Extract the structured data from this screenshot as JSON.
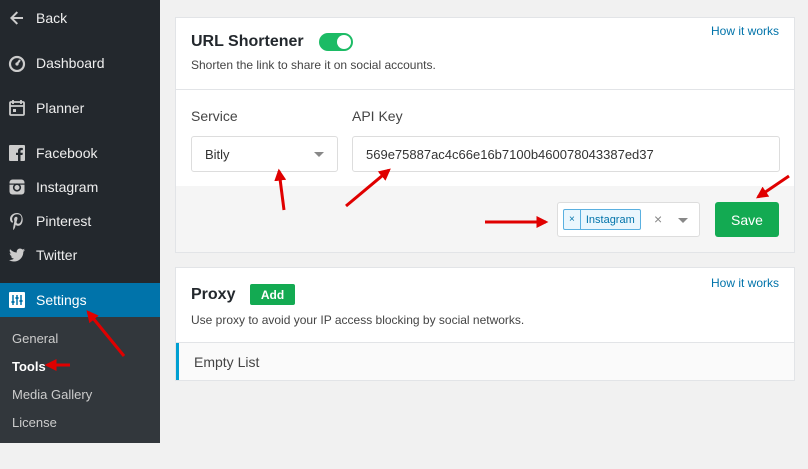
{
  "sidebar": {
    "back_label": "Back",
    "items": [
      {
        "label": "Dashboard",
        "icon": "dashboard-icon"
      },
      {
        "label": "Planner",
        "icon": "calendar-icon"
      },
      {
        "label": "Facebook",
        "icon": "facebook-icon"
      },
      {
        "label": "Instagram",
        "icon": "instagram-icon"
      },
      {
        "label": "Pinterest",
        "icon": "pinterest-icon"
      },
      {
        "label": "Twitter",
        "icon": "twitter-icon"
      },
      {
        "label": "Settings",
        "icon": "settings-icon",
        "active": true
      }
    ],
    "submenu": [
      {
        "label": "General"
      },
      {
        "label": "Tools",
        "current": true
      },
      {
        "label": "Media Gallery"
      },
      {
        "label": "License"
      }
    ]
  },
  "url_shortener": {
    "title": "URL Shortener",
    "enabled": true,
    "description": "Shorten the link to share it on social accounts.",
    "how_it_works": "How it works",
    "service_label": "Service",
    "service_value": "Bitly",
    "api_key_label": "API Key",
    "api_key_value": "569e75887ac4c66e16b7100b460078043387ed37",
    "accounts_tag": "Instagram",
    "tag_remove": "×",
    "clear": "×",
    "save_label": "Save"
  },
  "proxy": {
    "title": "Proxy",
    "add_label": "Add",
    "description": "Use proxy to avoid your IP access blocking by social networks.",
    "how_it_works": "How it works",
    "empty_text": "Empty List"
  },
  "colors": {
    "sidebar_bg": "#23282d",
    "active_bg": "#0073aa",
    "accent_green": "#13aa52",
    "link": "#0073aa",
    "annotation_arrow": "#e00000"
  }
}
